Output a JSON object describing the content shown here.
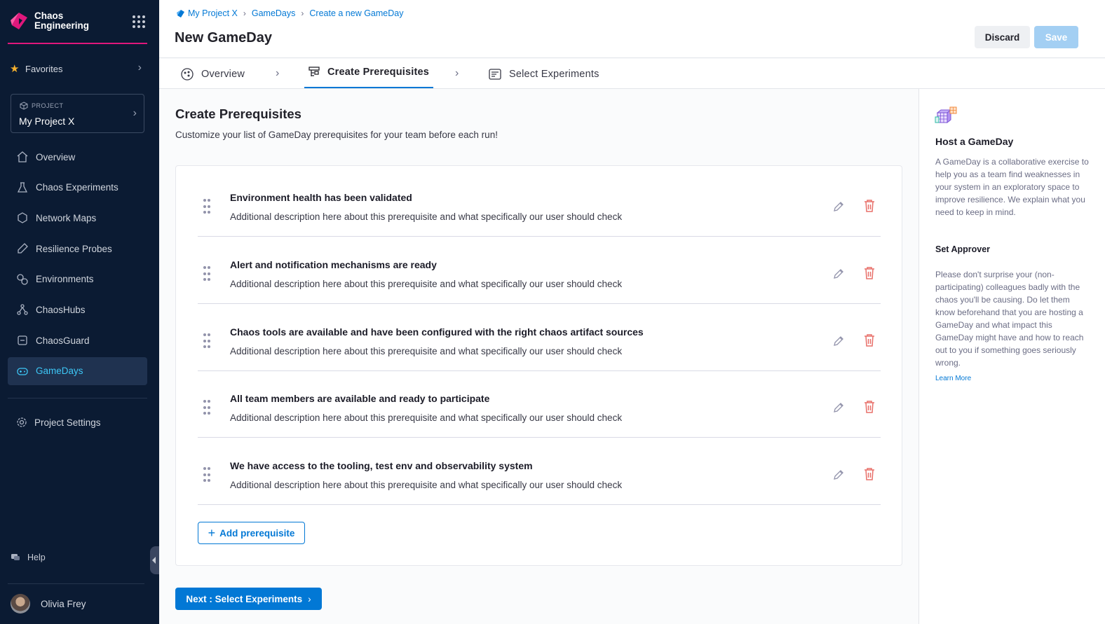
{
  "brand": {
    "line1": "Chaos",
    "line2": "Engineering",
    "accent": "#e0177c"
  },
  "sidebar": {
    "favorites": "Favorites",
    "project_label": "PROJECT",
    "project_name": "My Project X",
    "items": [
      {
        "label": "Overview",
        "icon": "home-icon"
      },
      {
        "label": "Chaos Experiments",
        "icon": "flask-icon"
      },
      {
        "label": "Network Maps",
        "icon": "hexagon-icon"
      },
      {
        "label": "Resilience Probes",
        "icon": "probe-icon"
      },
      {
        "label": "Environments",
        "icon": "environments-icon"
      },
      {
        "label": "ChaosHubs",
        "icon": "hub-icon"
      },
      {
        "label": "ChaosGuard",
        "icon": "guard-icon"
      },
      {
        "label": "GameDays",
        "icon": "gamepad-icon",
        "active": true
      }
    ],
    "project_settings": "Project Settings",
    "help": "Help",
    "user_name": "Olivia Frey"
  },
  "header": {
    "breadcrumb": [
      "My Project X",
      "GameDays",
      "Create a new GameDay"
    ],
    "title": "New GameDay",
    "discard_label": "Discard",
    "save_label": "Save"
  },
  "tabs": [
    {
      "label": "Overview",
      "icon": "overview-icon"
    },
    {
      "label": "Create Prerequisites",
      "icon": "prerequisites-icon",
      "active": true
    },
    {
      "label": "Select Experiments",
      "icon": "experiments-icon"
    }
  ],
  "main": {
    "title": "Create Prerequisites",
    "subtitle": "Customize your list of GameDay prerequisites for your team before each run!",
    "prerequisites": [
      {
        "title": "Environment health has been validated",
        "description": "Additional description here about this prerequisite and what specifically our user should check"
      },
      {
        "title": "Alert and notification mechanisms are ready",
        "description": "Additional description here about this prerequisite and what specifically our user should check"
      },
      {
        "title": "Chaos tools are available and have been configured with the right chaos artifact sources",
        "description": "Additional description here about this prerequisite and what specifically our user should check"
      },
      {
        "title": "All team members are available and ready to participate",
        "description": "Additional description here about this prerequisite and what specifically our user should check"
      },
      {
        "title": "We have access to the tooling, test env and observability system",
        "description": "Additional description here about this prerequisite and what specifically our user should check"
      }
    ],
    "add_label": "Add prerequisite",
    "next_label": "Next : Select Experiments"
  },
  "right_panel": {
    "title": "Host a GameDay",
    "text": "A GameDay is a collaborative exercise to help you as a team find weaknesses in your system in an exploratory space to improve resilience. We explain what you need to keep in mind.",
    "subtitle": "Set Approver",
    "text2": "Please don't surprise your (non-participating) colleagues badly with the chaos you'll be causing. Do let them know beforehand that you are hosting a GameDay and what impact this GameDay might have and how to reach out to you if something goes seriously wrong.",
    "link": "Learn More"
  },
  "colors": {
    "primary": "#0278d5",
    "sidebar_bg": "#0b1b33",
    "active_nav": "#3dc7f6",
    "delete": "#e8706a"
  }
}
